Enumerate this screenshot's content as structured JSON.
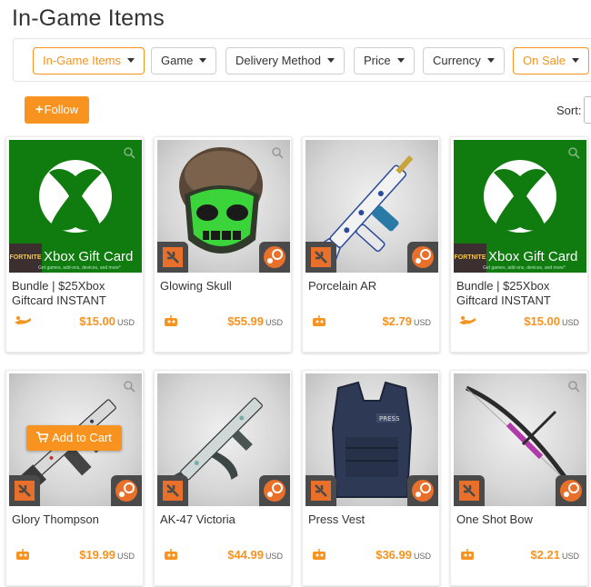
{
  "page": {
    "title": "In-Game Items"
  },
  "filters": [
    {
      "label": "In-Game Items",
      "active": true
    },
    {
      "label": "Game",
      "active": false
    },
    {
      "label": "Delivery Method",
      "active": false
    },
    {
      "label": "Price",
      "active": false
    },
    {
      "label": "Currency",
      "active": false
    },
    {
      "label": "On Sale",
      "active": true
    }
  ],
  "toolbar": {
    "follow_label": "Follow",
    "sort_label": "Sort:"
  },
  "add_to_cart_label": "Add to Cart",
  "xbox_art": {
    "caption": "Xbox Gift Card",
    "subtext": "Get games, add-ons, devices, and more*",
    "corner_label": "FORTNITE"
  },
  "colors": {
    "accent": "#f7931e",
    "xbox_green": "#107c10",
    "badge_gray": "#4a4a4a"
  },
  "products": [
    {
      "name": "Bundle | $25Xbox Giftcard INSTANT",
      "price": "$15.00",
      "currency": "USD",
      "image": "xbox-gift-card",
      "delivery_icon": "instant-delivery-icon"
    },
    {
      "name": "Glowing Skull",
      "price": "$55.99",
      "currency": "USD",
      "image": "glowing-skull-mask",
      "delivery_icon": "bot-delivery-icon"
    },
    {
      "name": "Porcelain AR",
      "price": "$2.79",
      "currency": "USD",
      "image": "porcelain-ar-rifle",
      "delivery_icon": "bot-delivery-icon"
    },
    {
      "name": "Bundle | $25Xbox Giftcard INSTANT",
      "price": "$15.00",
      "currency": "USD",
      "image": "xbox-gift-card",
      "delivery_icon": "instant-delivery-icon"
    },
    {
      "name": "Glory Thompson",
      "price": "$19.99",
      "currency": "USD",
      "image": "thompson-smg",
      "delivery_icon": "bot-delivery-icon"
    },
    {
      "name": "AK-47 Victoria",
      "price": "$44.99",
      "currency": "USD",
      "image": "ak47-rifle",
      "delivery_icon": "bot-delivery-icon"
    },
    {
      "name": "Press Vest",
      "price": "$36.99",
      "currency": "USD",
      "image": "press-vest",
      "delivery_icon": "bot-delivery-icon"
    },
    {
      "name": "One Shot Bow",
      "price": "$2.21",
      "currency": "USD",
      "image": "compound-bow",
      "delivery_icon": "bot-delivery-icon"
    }
  ]
}
